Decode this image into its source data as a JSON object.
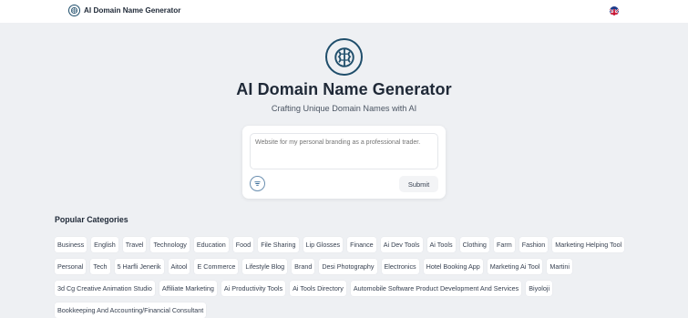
{
  "header": {
    "brand_icon": "brain-globe-icon",
    "brand_name": "AI Domain Name Generator",
    "language_icon": "uk-flag-icon"
  },
  "hero": {
    "logo_icon": "brain-globe-icon",
    "title": "AI Domain Name Generator",
    "subtitle": "Crafting Unique Domain Names with AI"
  },
  "form": {
    "prompt_placeholder": "Website for my personal branding as a professional trader.",
    "filter_icon": "filter-lines-icon",
    "submit_label": "Submit"
  },
  "categories": {
    "heading": "Popular Categories",
    "items": [
      "Business",
      "English",
      "Travel",
      "Technology",
      "Education",
      "Food",
      "File Sharing",
      "Lip Glosses",
      "Finance",
      "Ai Dev Tools",
      "Ai Tools",
      "Clothing",
      "Farm",
      "Fashion",
      "Marketing Helping Tool",
      "Personal",
      "Tech",
      "5 Harfli Jenerik",
      "Aitool",
      "E Commerce",
      "Lifestyle Blog",
      "Brand",
      "Desi Photography",
      "Electronics",
      "Hotel Booking App",
      "Marketing Ai Tool",
      "Martini",
      "3d Cg Creative Animation Studio",
      "Affiliate Marketing",
      "Ai Productivity Tools",
      "Ai Tools Directory",
      "Automobile Software Product Development And Services",
      "Biyoloji",
      "Bookkeeping And Accounting/Financial Consultant"
    ]
  },
  "colors": {
    "background": "#eef0f3",
    "accent": "#1f4e6b",
    "card": "#ffffff"
  }
}
